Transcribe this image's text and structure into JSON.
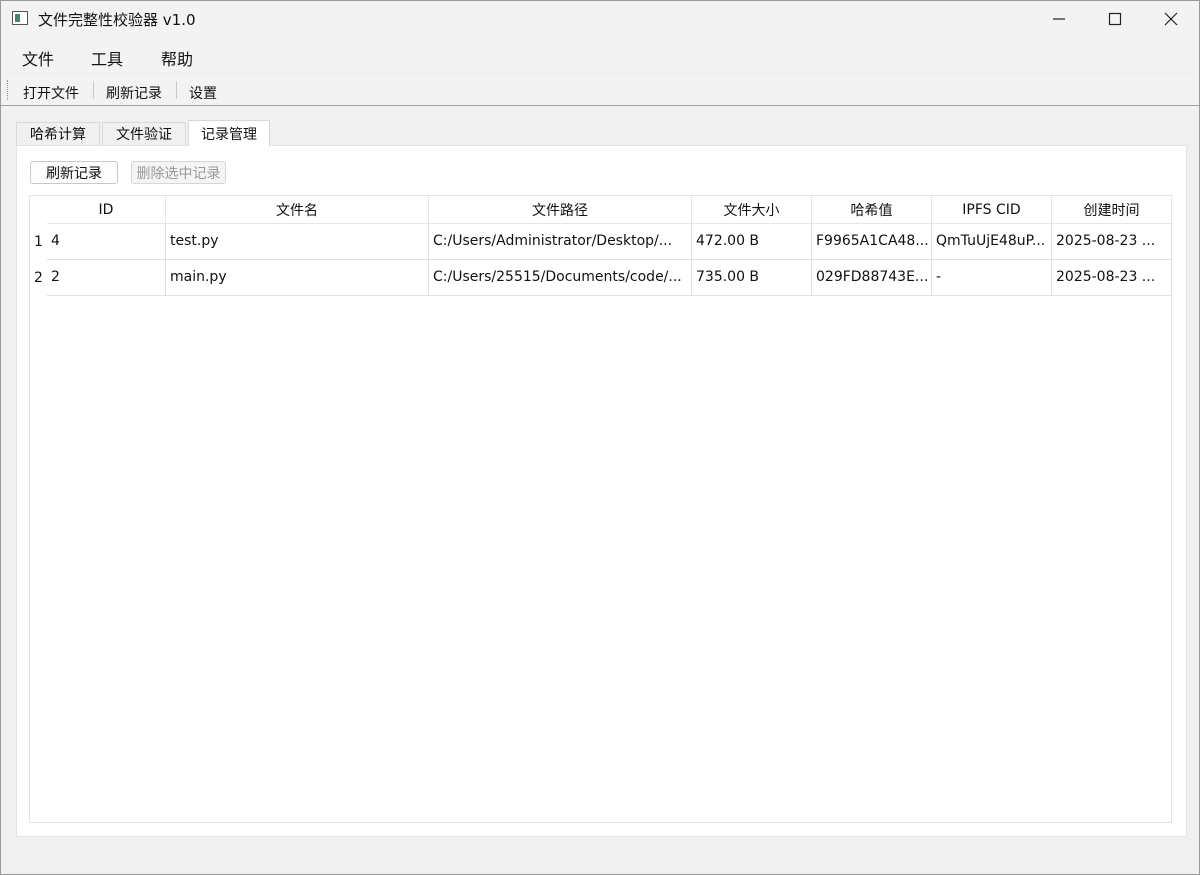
{
  "window": {
    "title": "文件完整性校验器 v1.0",
    "controls": {
      "minimize": "—",
      "maximize": "☐",
      "close": "✕"
    }
  },
  "menu": {
    "file": "文件",
    "tools": "工具",
    "help": "帮助"
  },
  "toolbar": {
    "open_file": "打开文件",
    "refresh_records": "刷新记录",
    "settings": "设置"
  },
  "tabs": [
    {
      "label": "哈希计算",
      "active": false
    },
    {
      "label": "文件验证",
      "active": false
    },
    {
      "label": "记录管理",
      "active": true
    }
  ],
  "records_panel": {
    "refresh_button": "刷新记录",
    "delete_button": "删除选中记录",
    "delete_enabled": false,
    "columns": [
      "ID",
      "文件名",
      "文件路径",
      "文件大小",
      "哈希值",
      "IPFS CID",
      "创建时间"
    ],
    "row_numbers": [
      "1",
      "2"
    ],
    "rows": [
      [
        "4",
        "test.py",
        "C:/Users/Administrator/Desktop/...",
        "472.00 B",
        "F9965A1CA48...",
        "QmTuUjE48uP...",
        "2025-08-23 ..."
      ],
      [
        "2",
        "main.py",
        "C:/Users/25515/Documents/code/...",
        "735.00 B",
        "029FD88743E...",
        "-",
        "2025-08-23 ..."
      ]
    ]
  },
  "icons": {
    "app": "app-icon",
    "minimize": "minimize-icon",
    "maximize": "maximize-icon",
    "close": "close-icon"
  }
}
